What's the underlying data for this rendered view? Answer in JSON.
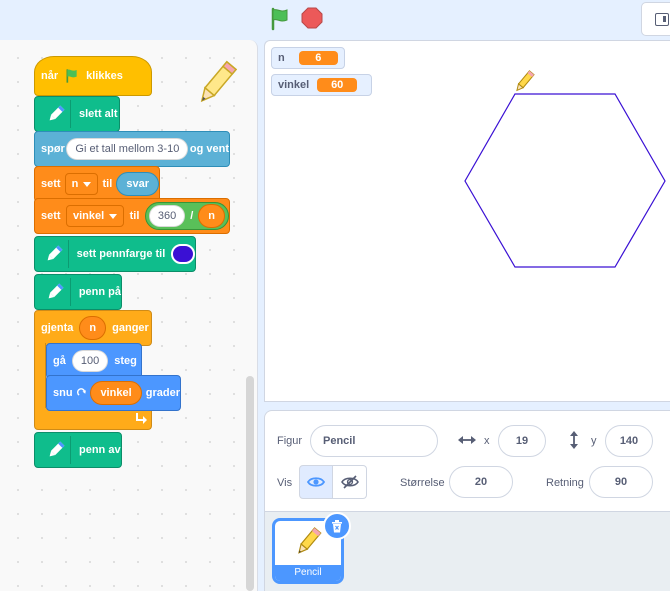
{
  "variables": [
    {
      "name": "n",
      "value": "6"
    },
    {
      "name": "vinkel",
      "value": "60"
    }
  ],
  "script": {
    "when_flag": {
      "pre": "når",
      "post": "klikkes"
    },
    "clear": "slett alt",
    "ask": {
      "label": "spør",
      "question": "Gi et tall mellom 3-10",
      "suffix": "og vent"
    },
    "set_n": {
      "label": "sett",
      "var": "n",
      "to": "til",
      "value": "svar"
    },
    "set_vinkel": {
      "label": "sett",
      "var": "vinkel",
      "to": "til",
      "dividend": "360",
      "operator": "/",
      "divisor": "n"
    },
    "pen_color": {
      "label": "sett pennfarge til",
      "color": "#3a10d4"
    },
    "pen_down": "penn på",
    "repeat": {
      "label": "gjenta",
      "count": "n",
      "suffix": "ganger"
    },
    "move": {
      "label": "gå",
      "steps": "100",
      "suffix": "steg"
    },
    "turn": {
      "label": "snu",
      "value": "vinkel",
      "suffix": "grader"
    },
    "pen_up": "penn av"
  },
  "sprite_info": {
    "sprite_label": "Figur",
    "sprite_name": "Pencil",
    "x_label": "x",
    "x_value": "19",
    "y_label": "y",
    "y_value": "140",
    "show_label": "Vis",
    "size_label": "Størrelse",
    "size_value": "20",
    "direction_label": "Retning",
    "direction_value": "90"
  },
  "sprite_list": [
    {
      "name": "Pencil",
      "selected": true
    }
  ],
  "colors": {
    "pen": "#3a10d4",
    "accent": "#4c97ff",
    "event": "#ffbf00",
    "pen_ext": "#0fbd8c",
    "variables": "#ff8c1a",
    "control": "#ffab19",
    "motion": "#4c97ff",
    "sensing": "#5cb1d6",
    "operators": "#59c059"
  },
  "icons": [
    "green-flag-icon",
    "stop-icon",
    "layout-toggle-icon",
    "pencil-icon",
    "pen-extension-icon",
    "turn-right-icon",
    "repeat-arrow-icon",
    "x-arrows-icon",
    "y-arrows-icon",
    "eye-icon",
    "eye-off-icon",
    "trash-icon"
  ]
}
